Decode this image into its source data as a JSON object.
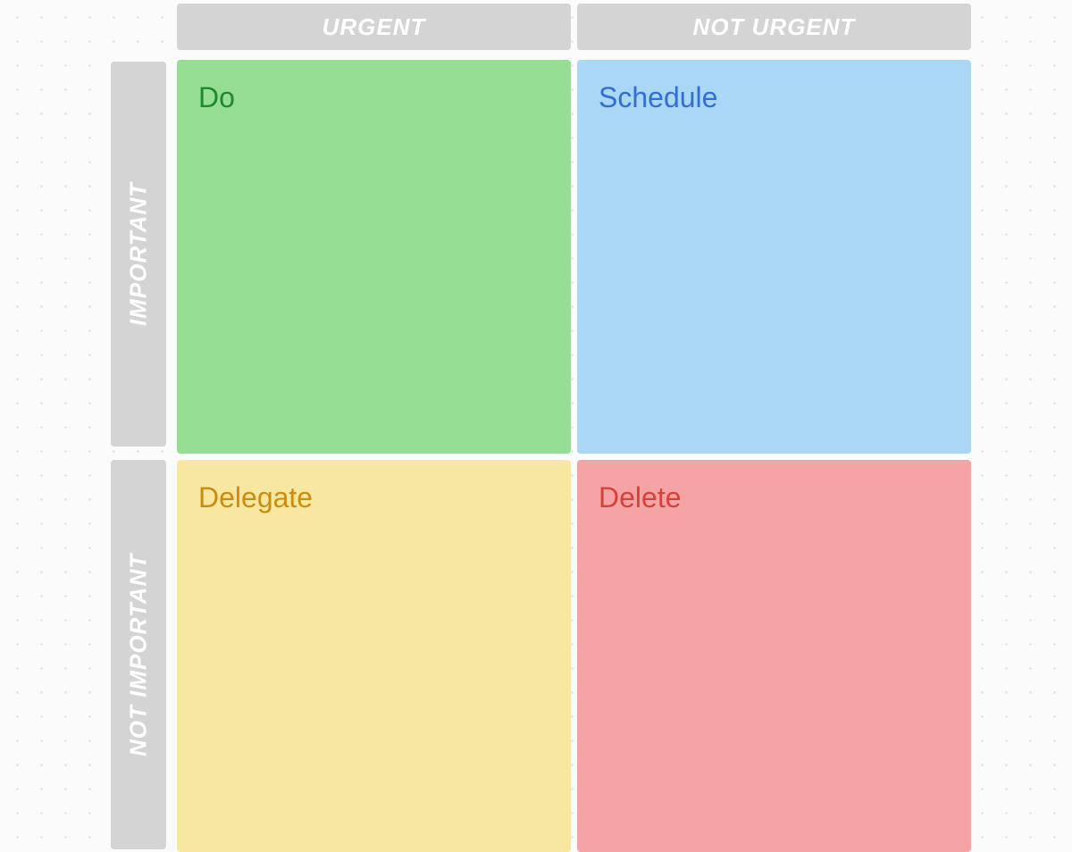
{
  "columns": {
    "left": "URGENT",
    "right": "NOT URGENT"
  },
  "rows": {
    "top": "IMPORTANT",
    "bottom": "NOT IMPORTANT"
  },
  "quadrants": {
    "do": "Do",
    "schedule": "Schedule",
    "delegate": "Delegate",
    "delete": "Delete"
  }
}
